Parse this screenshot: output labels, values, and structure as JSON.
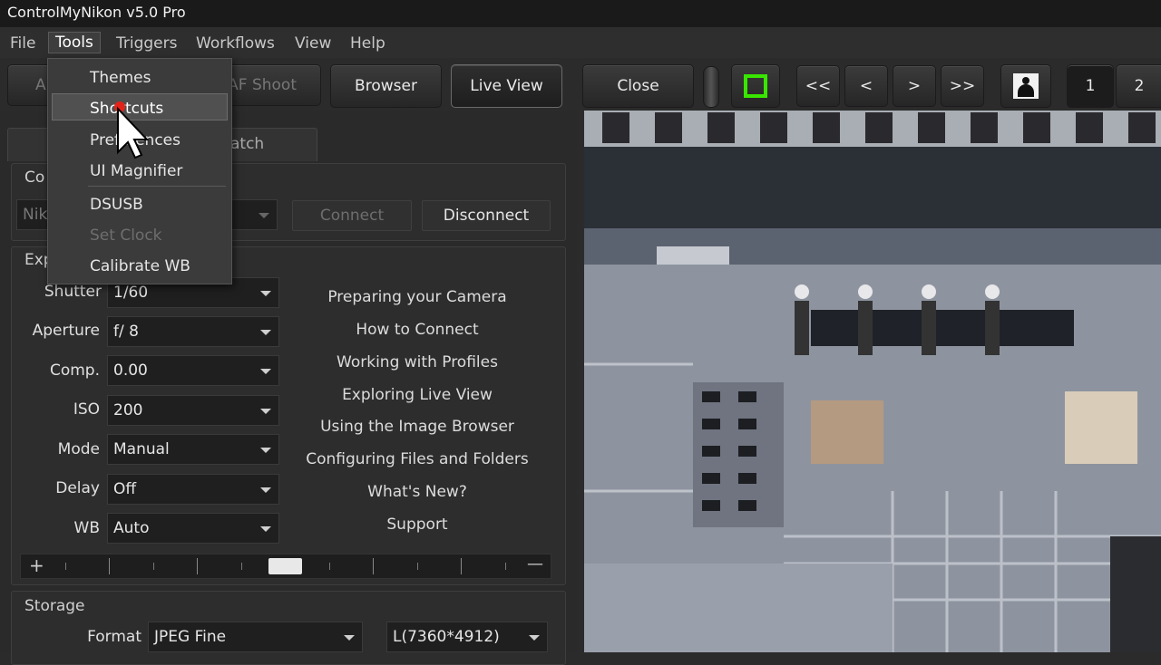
{
  "window": {
    "title": "ControlMyNikon v5.0 Pro"
  },
  "menubar": [
    "File",
    "Tools",
    "Triggers",
    "Workflows",
    "View",
    "Help"
  ],
  "toolbar": {
    "partial_left_label": "A",
    "af_shoot_label": "AF Shoot",
    "browser_label": "Browser",
    "live_view_label": "Live View",
    "close_label": "Close",
    "nav_first": "<<",
    "nav_prev": "<",
    "nav_next": ">",
    "nav_last": ">>",
    "page_1": "1",
    "page_2": "2",
    "focus_box_color": "#39e600"
  },
  "tools_menu": {
    "items": [
      "Themes",
      "Shortcuts",
      "Preferences",
      "UI Magnifier",
      "DSUSB",
      "Set Clock",
      "Calibrate WB"
    ],
    "visible_partial_texts": {
      "shortcuts": "Shortcuts",
      "preferences": "Preferences"
    },
    "disabled": [
      "Set Clock"
    ],
    "highlighted": "Shortcuts"
  },
  "left_panel": {
    "tab_partial": "atch",
    "connection": {
      "title_partial": "Co",
      "camera_partial": "Nik",
      "connect_label": "Connect",
      "disconnect_label": "Disconnect"
    },
    "exposure": {
      "title_partial": "Exp",
      "fields": [
        {
          "label": "Shutter",
          "value": "1/60"
        },
        {
          "label": "Aperture",
          "value": "f/ 8"
        },
        {
          "label": "Comp.",
          "value": "0.00"
        },
        {
          "label": "ISO",
          "value": "200"
        },
        {
          "label": "Mode",
          "value": "Manual"
        },
        {
          "label": "Delay",
          "value": "Off"
        },
        {
          "label": "WB",
          "value": "Auto"
        }
      ],
      "help_links": [
        "Preparing your Camera",
        "How to Connect",
        "Working with Profiles",
        "Exploring Live View",
        "Using the Image Browser",
        "Configuring Files and Folders",
        "What's New?",
        "Support"
      ],
      "exposure_plus": "+",
      "exposure_minus": "—"
    },
    "storage": {
      "title": "Storage",
      "format_label": "Format",
      "format_value": "JPEG Fine",
      "size_value": "L(7360*4912)"
    }
  }
}
